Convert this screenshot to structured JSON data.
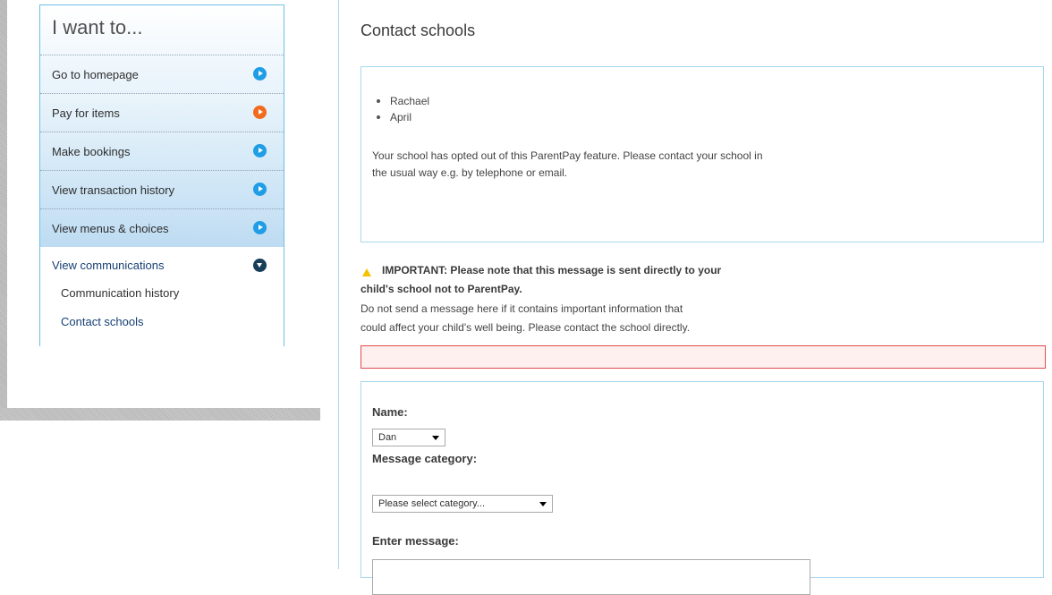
{
  "sidebar": {
    "title": "I want to...",
    "items": [
      {
        "label": "Go to homepage",
        "icon": "play-circle-icon",
        "icon_color": "#1f9ee6"
      },
      {
        "label": "Pay for items",
        "icon": "play-circle-icon",
        "icon_color": "#f26a1b"
      },
      {
        "label": "Make bookings",
        "icon": "play-circle-icon",
        "icon_color": "#1f9ee6"
      },
      {
        "label": "View transaction history",
        "icon": "play-circle-icon",
        "icon_color": "#1f9ee6"
      },
      {
        "label": "View menus & choices",
        "icon": "play-circle-icon",
        "icon_color": "#1f9ee6"
      }
    ],
    "expanded": {
      "label": "View communications",
      "icon": "chevron-down-circle-icon",
      "icon_color": "#173e5a",
      "subitems": [
        {
          "label": "Communication history"
        },
        {
          "label": "Contact schools"
        }
      ]
    }
  },
  "main": {
    "title": "Contact schools",
    "children": [
      "Rachael",
      "April"
    ],
    "optout_message": "Your school has opted out of this ParentPay feature. Please contact your school in the usual way e.g. by telephone or email.",
    "important_line1": "IMPORTANT: Please note that this message is sent directly to your",
    "important_line2": "child's school not to ParentPay.",
    "notice_line1": "Do not send a message here if it contains important information that",
    "notice_line2": "could affect your child's well being. Please contact the school directly.",
    "form": {
      "name_label": "Name:",
      "name_value": "Dan",
      "category_label": "Message category:",
      "category_value": "Please select category...",
      "message_label": "Enter message:"
    }
  },
  "colors": {
    "accent_blue": "#1f9ee6",
    "accent_orange": "#f26a1b",
    "dark_navy": "#173e5a",
    "border_blue": "#a7d7ee",
    "error_red": "#e04c4c",
    "link_navy": "#163f74"
  }
}
